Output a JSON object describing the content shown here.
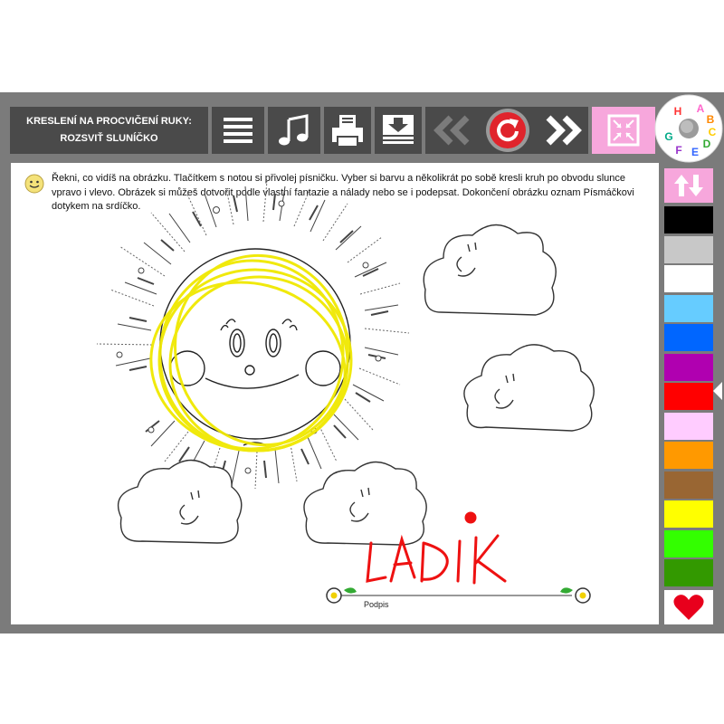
{
  "toolbar": {
    "title_line1": "KRESLENÍ NA PROCVIČENÍ RUKY:",
    "title_line2": "ROZSVIŤ SLUNÍČKO",
    "buttons": [
      "menu-icon",
      "music-note-icon",
      "print-icon",
      "download-icon",
      "previous-icon",
      "reload-icon",
      "next-icon",
      "fit-screen-icon"
    ],
    "abc_letters": [
      "A",
      "B",
      "C",
      "D",
      "E",
      "F",
      "G",
      "H"
    ]
  },
  "instructions": "Řekni, co vidíš na obrázku. Tlačítkem s notou si přivolej písničku. Vyber si barvu a několikrát po sobě kresli kruh po obvodu slunce vpravo i vlevo. Obrázek si můžeš dotvořit podle vlastní fantazie a nálady nebo se i podepsat. Dokončení obrázku oznam Písmáčkovi dotykem na srdíčko.",
  "drawing": {
    "signature": "LADIK",
    "signature_line_label": "Podpis"
  },
  "palette": {
    "colors": [
      "#000000",
      "#c8c8c8",
      "#ffffff",
      "#66ccff",
      "#0066ff",
      "#b000b0",
      "#ff0000",
      "#ffccff",
      "#ff9900",
      "#996633",
      "#ffff00",
      "#33ff00",
      "#339900"
    ]
  },
  "colors": {
    "frame": "#7b7b7b",
    "toolbar": "#4a4a4a",
    "accent_pink": "#f7a7dc",
    "heart": "#e8001c",
    "sun_stroke": "#f0e800"
  }
}
